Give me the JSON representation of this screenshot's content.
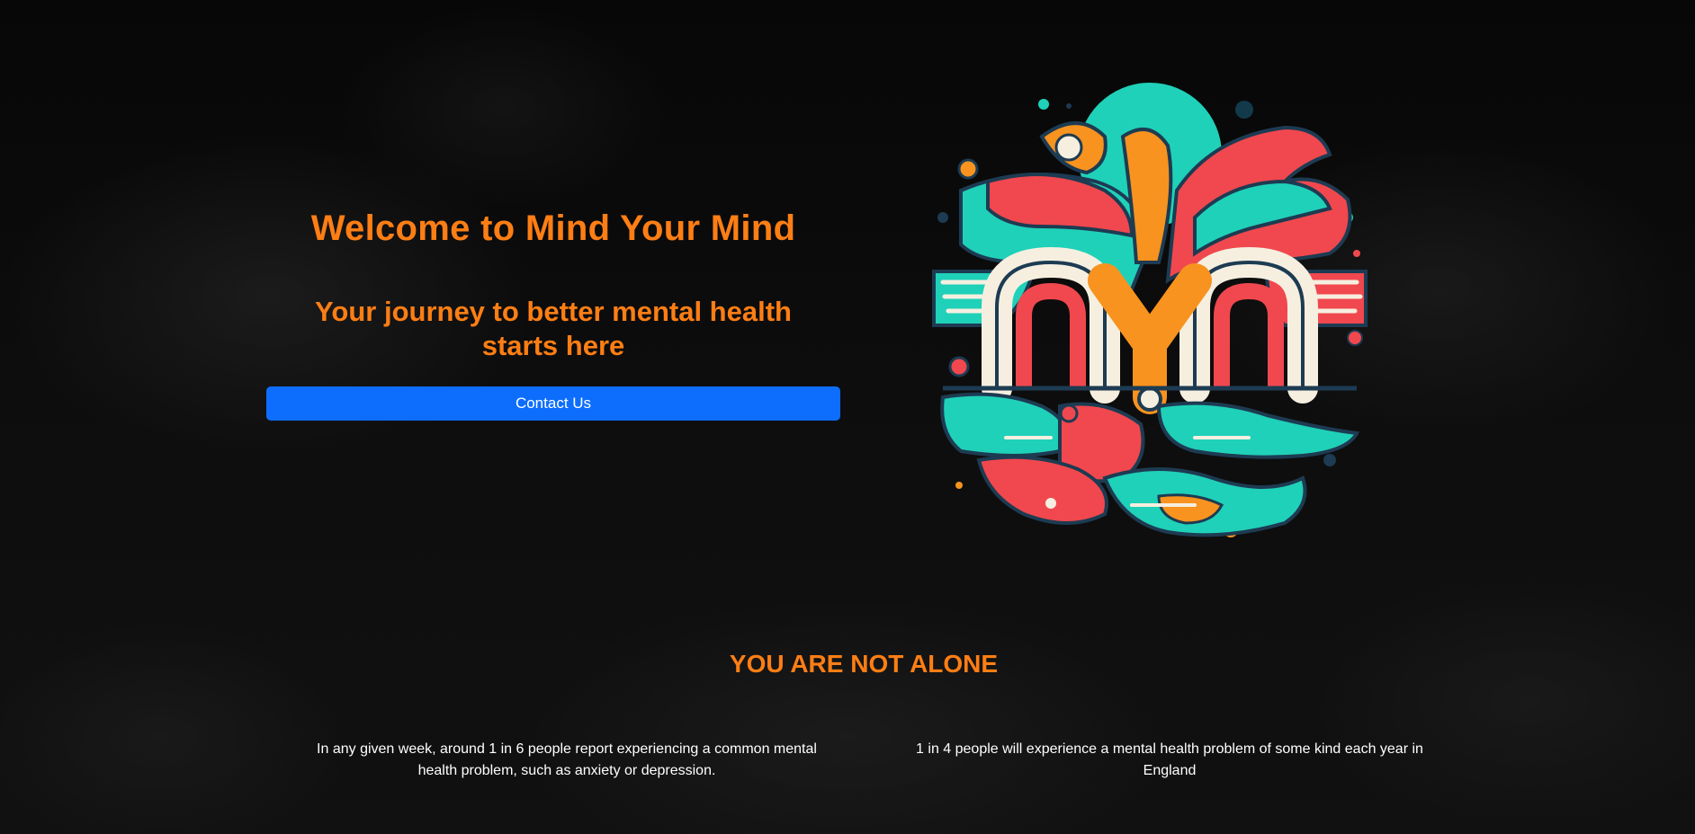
{
  "hero": {
    "title": "Welcome to Mind Your Mind",
    "subtitle": "Your journey to better mental health starts here",
    "contact_button": "Contact Us"
  },
  "logo": {
    "icon": "mind-your-mind-logo",
    "letters": "MYM"
  },
  "section": {
    "title": "YOU ARE NOT ALONE"
  },
  "stats": [
    "In any given week, around 1 in 6 people report experiencing a common mental health problem, such as anxiety or depression.",
    "1 in 4 people will experience a mental health problem of some kind each year in England"
  ],
  "colors": {
    "accent": "#fd7e14",
    "button": "#0d6efd",
    "background": "#0b0b0b",
    "text": "#ffffff",
    "logo_teal": "#1fd1b8",
    "logo_red": "#f0484e",
    "logo_orange": "#f7931e",
    "logo_cream": "#f6efe0"
  }
}
